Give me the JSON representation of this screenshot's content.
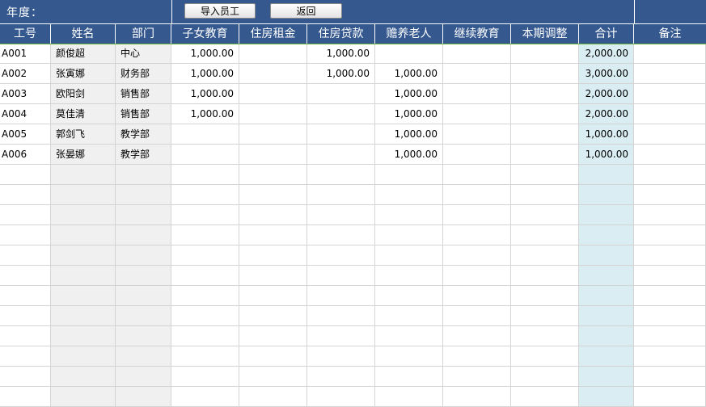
{
  "toolbar": {
    "year_label": "年度：",
    "import_button": "导入员工",
    "back_button": "返回"
  },
  "columns": [
    "工号",
    "姓名",
    "部门",
    "子女教育",
    "住房租金",
    "住房贷款",
    "赡养老人",
    "继续教育",
    "本期调整",
    "合计",
    "备注"
  ],
  "rows": [
    [
      "A001",
      "颜俊超",
      "中心",
      "1,000.00",
      "",
      "1,000.00",
      "",
      "",
      "",
      "2,000.00",
      ""
    ],
    [
      "A002",
      "张寅娜",
      "财务部",
      "1,000.00",
      "",
      "1,000.00",
      "1,000.00",
      "",
      "",
      "3,000.00",
      ""
    ],
    [
      "A003",
      "欧阳剑",
      "销售部",
      "1,000.00",
      "",
      "",
      "1,000.00",
      "",
      "",
      "2,000.00",
      ""
    ],
    [
      "A004",
      "莫佳清",
      "销售部",
      "1,000.00",
      "",
      "",
      "1,000.00",
      "",
      "",
      "2,000.00",
      ""
    ],
    [
      "A005",
      "郭剑飞",
      "教学部",
      "",
      "",
      "",
      "1,000.00",
      "",
      "",
      "1,000.00",
      ""
    ],
    [
      "A006",
      "张晏娜",
      "教学部",
      "",
      "",
      "",
      "1,000.00",
      "",
      "",
      "1,000.00",
      ""
    ]
  ],
  "colors": {
    "header_bg": "#35598f",
    "header_text": "#ffffff",
    "total_col_bg": "#daedf3",
    "name_col_bg": "#f0f0f0",
    "grid_line": "#d4d4d4"
  }
}
